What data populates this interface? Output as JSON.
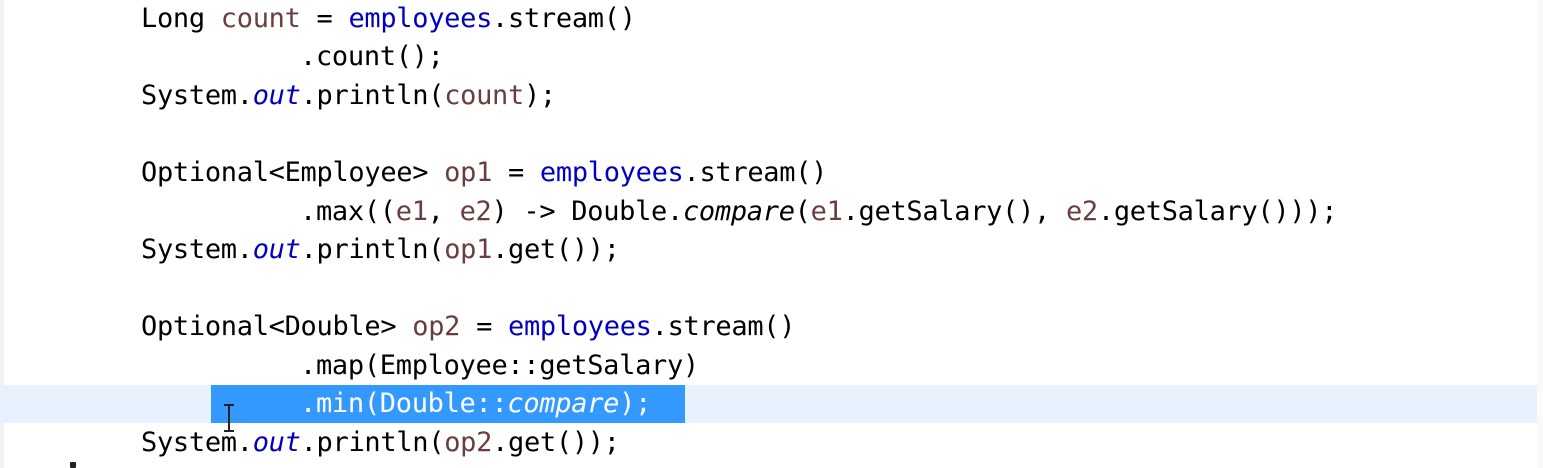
{
  "editor": {
    "lines": [
      {
        "parts": [
          "Long ",
          "count",
          " = ",
          "employees",
          ".stream()"
        ]
      },
      {
        "parts": [
          ".count();"
        ]
      },
      {
        "parts": [
          "System.",
          "out",
          ".println(",
          "count",
          ");"
        ]
      },
      {
        "parts": [
          "Optional<Employee> ",
          "op1",
          " = ",
          "employees",
          ".stream()"
        ]
      },
      {
        "parts": [
          ".max((",
          "e1",
          ", ",
          "e2",
          ") -> Double.",
          "compare",
          "(",
          "e1",
          ".getSalary(), ",
          "e2",
          ".getSalary()));"
        ]
      },
      {
        "parts": [
          "System.",
          "out",
          ".println(",
          "op1",
          ".get());"
        ]
      },
      {
        "parts": [
          "Optional<Double> ",
          "op2",
          " = ",
          "employees",
          ".stream()"
        ]
      },
      {
        "parts": [
          ".map(Employee::getSalary)"
        ]
      },
      {
        "parts": [
          ".min(Double::",
          "compare",
          ");"
        ]
      },
      {
        "parts": [
          "System.",
          "out",
          ".println(",
          "op2",
          ".get());"
        ]
      }
    ],
    "colors": {
      "keyword": "#000000",
      "local_variable": "#6a3e3e",
      "field": "#0000c0",
      "selection": "#3399ff",
      "current_line": "#e8f2fe"
    }
  }
}
